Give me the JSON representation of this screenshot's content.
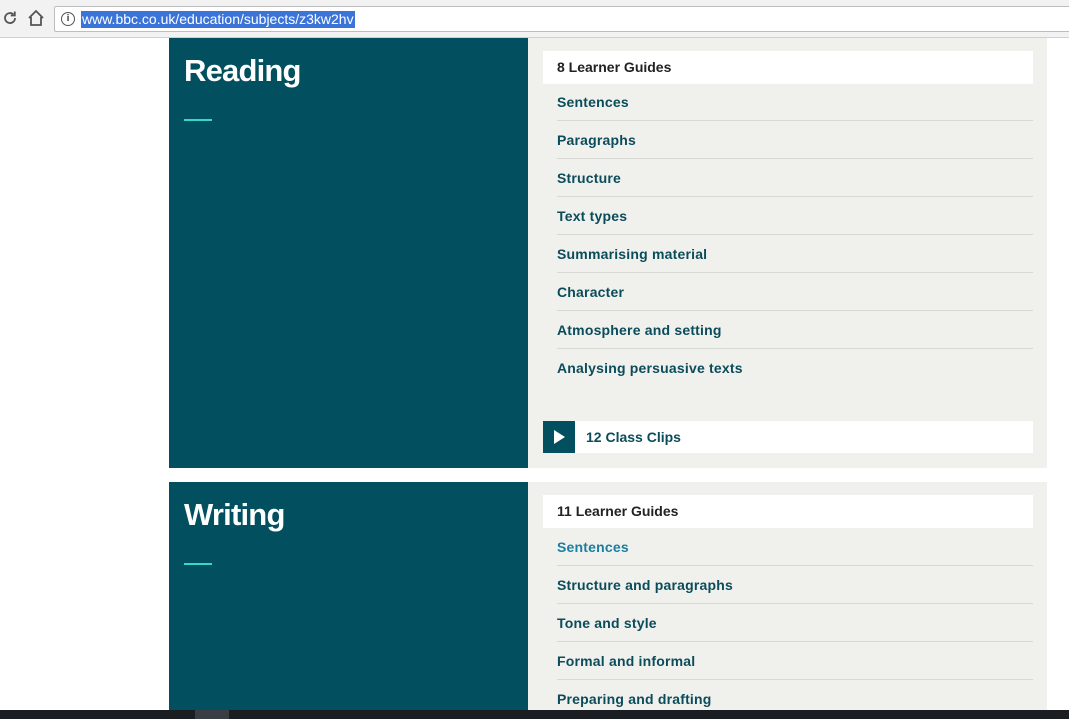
{
  "browser": {
    "url": "www.bbc.co.uk/education/subjects/z3kw2hv",
    "icons": {
      "reload": "reload-icon",
      "home": "home-icon",
      "info": "info-icon"
    }
  },
  "reading": {
    "title": "Reading",
    "guides_count": "8 Learner Guides",
    "guides": [
      "Sentences",
      "Paragraphs",
      "Structure",
      "Text types",
      "Summarising material",
      "Character",
      "Atmosphere and setting",
      "Analysing persuasive texts"
    ],
    "clips_label": "12 Class Clips"
  },
  "writing": {
    "title": "Writing",
    "guides_count": "11 Learner Guides",
    "guides": [
      "Sentences",
      "Structure and paragraphs",
      "Tone and style",
      "Formal and informal",
      "Preparing and drafting"
    ]
  },
  "colors": {
    "panel": "#02505f",
    "accent": "#3bd7c6",
    "link": "#0b4c5a",
    "link_active": "#1a7fa0",
    "right_bg": "#f0f0ed"
  }
}
